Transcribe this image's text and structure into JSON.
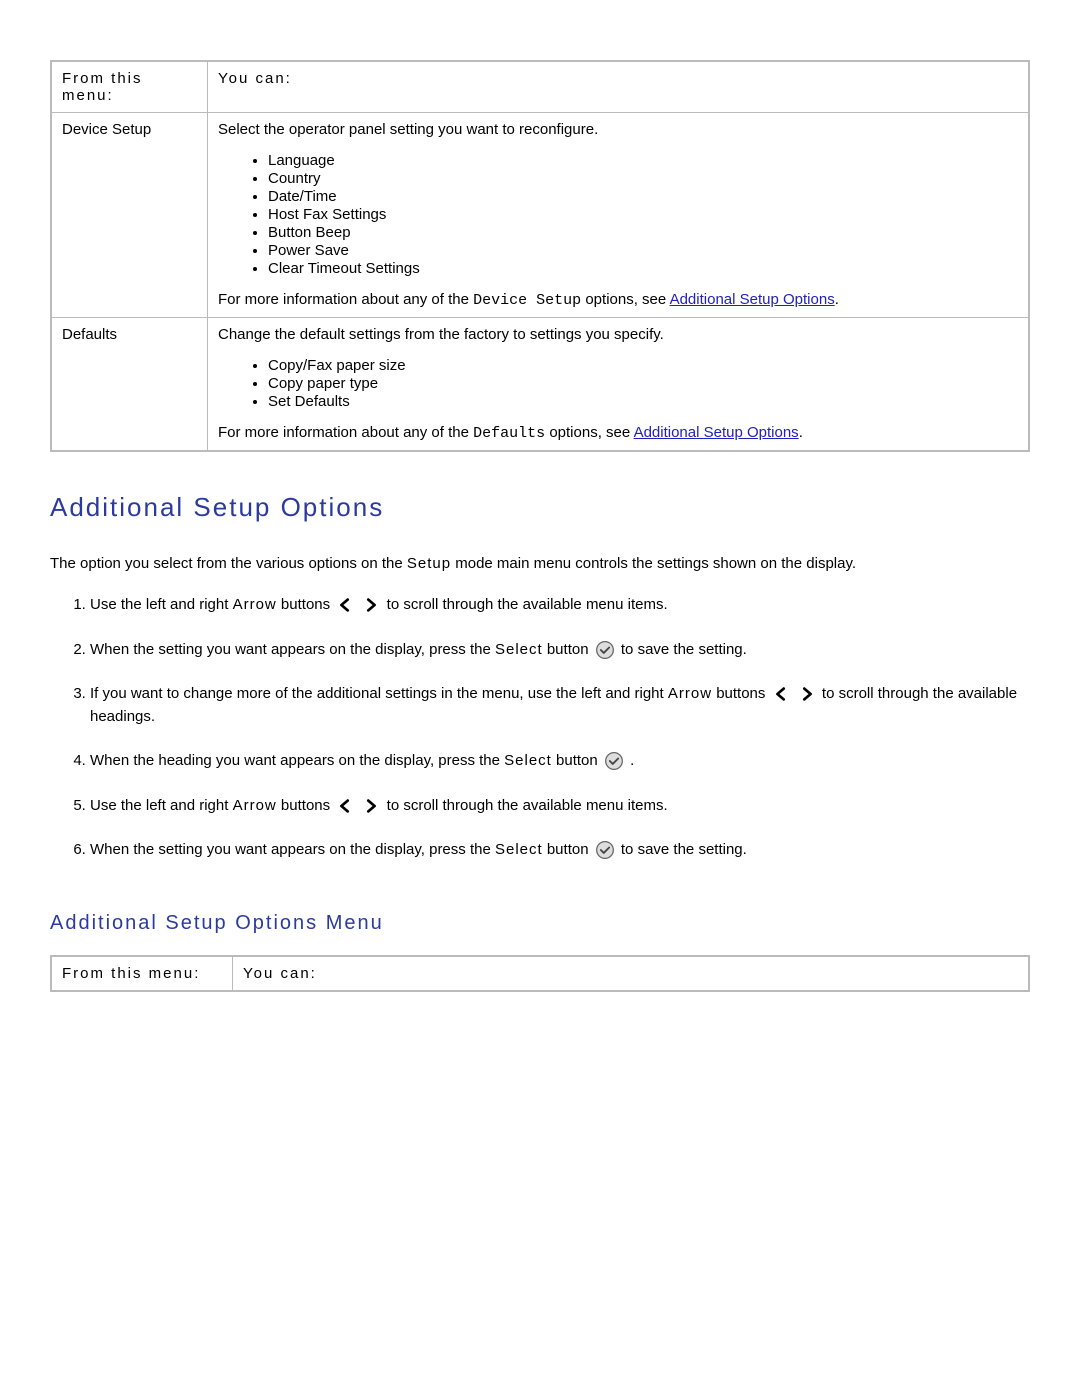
{
  "table1": {
    "header": {
      "col1": "From this menu:",
      "col2": "You can:"
    },
    "rows": [
      {
        "menu": "Device Setup",
        "intro": "Select the operator panel setting you want to reconfigure.",
        "items": [
          "Language",
          "Country",
          "Date/Time",
          "Host Fax Settings",
          "Button Beep",
          "Power Save",
          "Clear Timeout Settings"
        ],
        "more_pre": "For more information about any of the ",
        "more_code": "Device Setup",
        "more_mid": " options, see ",
        "more_link": "Additional Setup Options",
        "more_post": "."
      },
      {
        "menu": "Defaults",
        "intro": "Change the default settings from the factory to settings you specify.",
        "items": [
          "Copy/Fax paper size",
          "Copy paper type",
          "Set Defaults"
        ],
        "more_pre": "For more information about any of the ",
        "more_code": "Defaults",
        "more_mid": " options, see ",
        "more_link": "Additional Setup Options",
        "more_post": "."
      }
    ]
  },
  "section_heading": "Additional Setup Options",
  "intro_para_a": "The option you select from the various options on the ",
  "intro_para_b": "Setup",
  "intro_para_c": " mode main menu controls the settings shown on the display.",
  "steps": {
    "s1a": "Use the left and right ",
    "s1b": "Arrow",
    "s1c": " buttons ",
    "s1d": " to scroll through the available menu items.",
    "s2a": "When the setting you want appears on the display, press the ",
    "s2b": "Select",
    "s2c": " button ",
    "s2d": " to save the setting.",
    "s3a": "If you want to change more of the additional settings in the menu, use the left and right ",
    "s3b": "Arrow",
    "s3c": " buttons ",
    "s3d": " to scroll through the available headings.",
    "s4a": "When the heading you want appears on the display, press the ",
    "s4b": "Select",
    "s4c": " button ",
    "s4d": ".",
    "s5a": "Use the left and right ",
    "s5b": "Arrow",
    "s5c": " buttons ",
    "s5d": " to scroll through the available menu items.",
    "s6a": "When the setting you want appears on the display, press the ",
    "s6b": "Select",
    "s6c": " button ",
    "s6d": " to save the setting."
  },
  "sub_heading": "Additional Setup Options Menu",
  "table2": {
    "header": {
      "col1": "From this menu:",
      "col2": "You can:"
    }
  }
}
